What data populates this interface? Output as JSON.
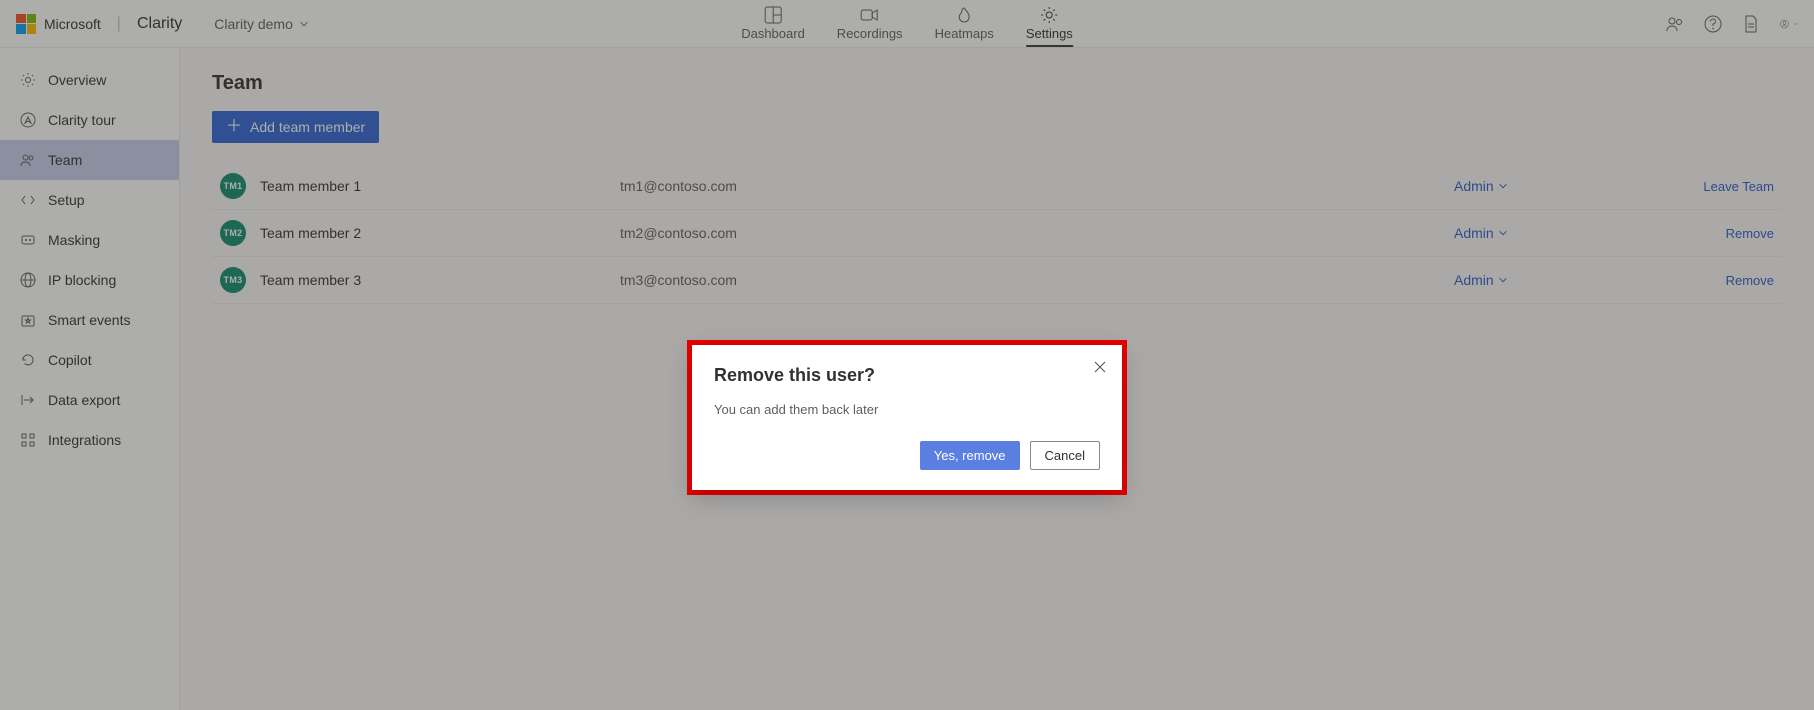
{
  "header": {
    "brand_company": "Microsoft",
    "brand_app": "Clarity",
    "project_name": "Clarity demo",
    "tabs": [
      {
        "label": "Dashboard"
      },
      {
        "label": "Recordings"
      },
      {
        "label": "Heatmaps"
      },
      {
        "label": "Settings"
      }
    ]
  },
  "sidebar": {
    "items": [
      {
        "label": "Overview"
      },
      {
        "label": "Clarity tour"
      },
      {
        "label": "Team"
      },
      {
        "label": "Setup"
      },
      {
        "label": "Masking"
      },
      {
        "label": "IP blocking"
      },
      {
        "label": "Smart events"
      },
      {
        "label": "Copilot"
      },
      {
        "label": "Data export"
      },
      {
        "label": "Integrations"
      }
    ]
  },
  "main": {
    "title": "Team",
    "add_button": "Add team member",
    "rows": [
      {
        "avatar": "TM1",
        "name": "Team member 1",
        "email": "tm1@contoso.com",
        "role": "Admin",
        "action": "Leave Team"
      },
      {
        "avatar": "TM2",
        "name": "Team member 2",
        "email": "tm2@contoso.com",
        "role": "Admin",
        "action": "Remove"
      },
      {
        "avatar": "TM3",
        "name": "Team member 3",
        "email": "tm3@contoso.com",
        "role": "Admin",
        "action": "Remove"
      }
    ]
  },
  "dialog": {
    "title": "Remove this user?",
    "text": "You can add them back later",
    "confirm": "Yes, remove",
    "cancel": "Cancel"
  }
}
